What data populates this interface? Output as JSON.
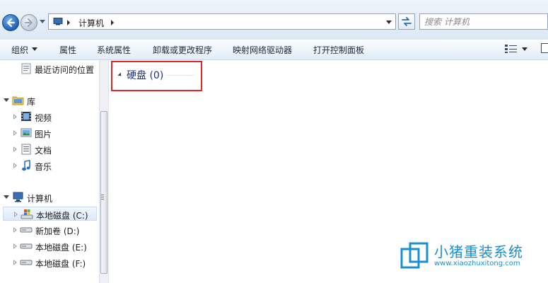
{
  "address_bar": {
    "crumb": "计算机",
    "search_placeholder": "搜索 计算机"
  },
  "toolbar": {
    "organize": "组织",
    "properties": "属性",
    "system_properties": "系统属性",
    "uninstall": "卸载或更改程序",
    "map_drive": "映射网络驱动器",
    "control_panel": "打开控制面板"
  },
  "nav": {
    "recent": "最近访问的位置",
    "libraries": "库",
    "lib_items": [
      "视频",
      "图片",
      "文档",
      "音乐"
    ],
    "computer": "计算机",
    "drives": [
      "本地磁盘 (C:)",
      "新加卷 (D:)",
      "本地磁盘 (E:)",
      "本地磁盘 (F:)"
    ]
  },
  "content": {
    "group_title": "硬盘 (0)"
  },
  "watermark": {
    "name": "小猪重装系统",
    "url": "www.xiaozhuxitong.com"
  },
  "colors": {
    "highlight": "#e1262a",
    "group_text": "#1e3287",
    "watermark": "#1a8fd2"
  }
}
